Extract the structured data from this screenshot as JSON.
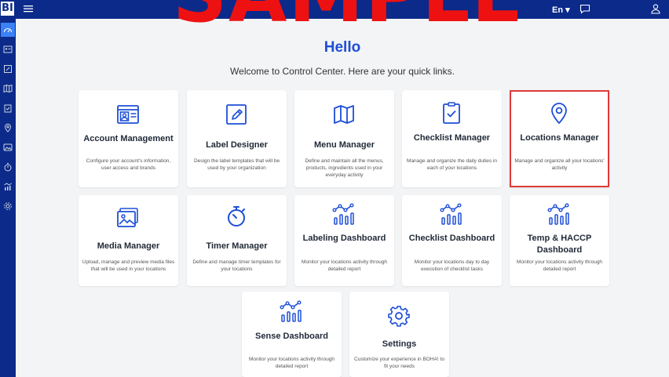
{
  "brand": {
    "logo_text": "BI"
  },
  "watermark": {
    "text": "SAMPLE"
  },
  "header": {
    "language_label": "En ▾"
  },
  "main": {
    "title": "Hello",
    "subtitle": "Welcome to Control Center. Here are your quick links."
  },
  "cards": [
    {
      "title": "Account Management",
      "desc": "Configure your account's information, user access and brands",
      "icon": "account-icon"
    },
    {
      "title": "Label Designer",
      "desc": "Design the label templates that will be used by your organization",
      "icon": "pencil-icon"
    },
    {
      "title": "Menu Manager",
      "desc": "Define and maintain all the menus, products, ingredients used in your everyday activity",
      "icon": "map-icon"
    },
    {
      "title": "Checklist Manager",
      "desc": "Manage and organize the daily duties in each of your locations",
      "icon": "clipboard-check-icon"
    },
    {
      "title": "Locations Manager",
      "desc": "Manage and organize all your locations' activity",
      "icon": "location-pin-icon"
    },
    {
      "title": "Media Manager",
      "desc": "Upload, manage and preview media files that will be used in your locations",
      "icon": "image-icon"
    },
    {
      "title": "Timer Manager",
      "desc": "Define and manage timer templates for your locations",
      "icon": "stopwatch-icon"
    },
    {
      "title": "Labeling Dashboard",
      "desc": "Monitor your locations activity through detailed report",
      "icon": "dashboard-chart-icon"
    },
    {
      "title": "Checklist Dashboard",
      "desc": "Monitor your locations day to day execution of checklist tasks",
      "icon": "dashboard-chart-icon"
    },
    {
      "title": "Temp & HACCP Dashboard",
      "desc": "Monitor your locations activity through detailed report",
      "icon": "dashboard-chart-icon"
    },
    {
      "title": "Sense Dashboard",
      "desc": "Monitor your locations activity through detailed report",
      "icon": "dashboard-chart-icon"
    },
    {
      "title": "Settings",
      "desc": "Customize your experience in BOHA! to fit your needs",
      "icon": "gear-icon"
    }
  ],
  "sidebar": {
    "icons": [
      "dashboard-icon",
      "id-card-icon",
      "edit-icon",
      "map-icon",
      "clipboard-icon",
      "location-pin-icon",
      "image-icon",
      "stopwatch-icon",
      "chart-icon",
      "gear-icon"
    ]
  },
  "colors": {
    "primary": "#0b2a8a",
    "accent": "#1d4ed8",
    "highlight": "#e03a3a",
    "sidebar_active": "#3b82f6"
  }
}
